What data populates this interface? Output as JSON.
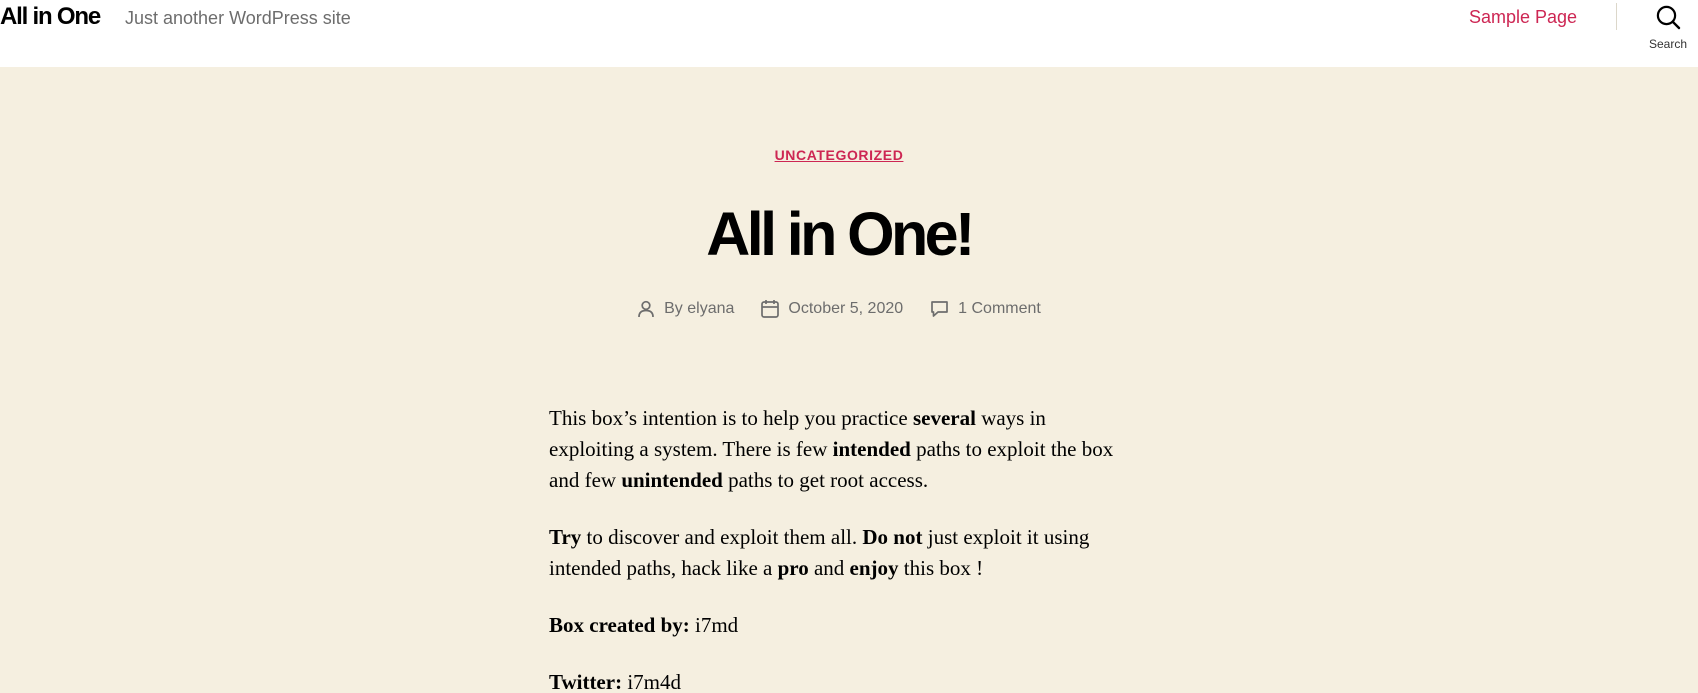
{
  "header": {
    "site_title": "All in One",
    "site_description": "Just another WordPress site",
    "menu": [
      {
        "label": "Sample Page"
      }
    ],
    "search_label": "Search"
  },
  "post": {
    "category": "UNCATEGORIZED",
    "title": "All in One!",
    "meta": {
      "author_prefix": "By",
      "author": "elyana",
      "date": "October 5, 2020",
      "comments": "1 Comment"
    },
    "content": {
      "p1": {
        "t1": "This box’s intention is to help you practice ",
        "b1": "several",
        "t2": " ways in exploiting a system. There is few ",
        "b2": "intended",
        "t3": " paths to exploit the box and few ",
        "b3": "unintended",
        "t4": " paths to get root access."
      },
      "p2": {
        "b1": "Try",
        "t1": " to discover and exploit them all. ",
        "b2": "Do not",
        "t2": " just exploit it using intended paths, hack like a ",
        "b3": "pro",
        "t3": " and ",
        "b4": "enjoy",
        "t4": " this box !"
      },
      "p3": {
        "label": "Box created by:",
        "value": " i7md"
      },
      "p4": {
        "label": "Twitter:",
        "value": " i7m4d"
      }
    }
  },
  "colors": {
    "accent": "#cd2653",
    "background": "#f5efe0",
    "header_background": "#ffffff",
    "meta_text": "#6d6d6d"
  },
  "icons": {
    "search": "search-icon",
    "author": "user-icon",
    "date": "calendar-icon",
    "comments": "comment-icon"
  }
}
